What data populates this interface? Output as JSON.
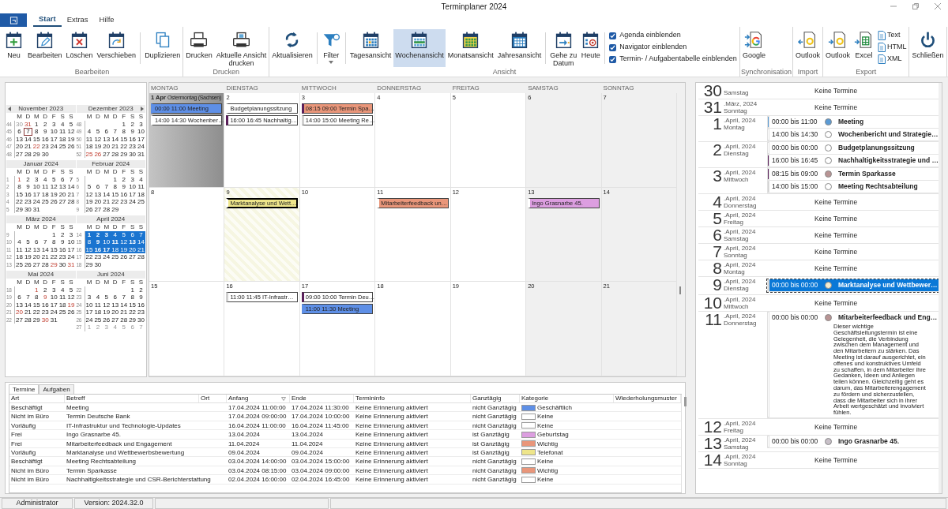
{
  "window": {
    "title": "Terminplaner 2024"
  },
  "ribbon_tabs": [
    {
      "label": "Start",
      "selected": true
    },
    {
      "label": "Extras",
      "selected": false
    },
    {
      "label": "Hilfe",
      "selected": false
    }
  ],
  "ribbon_groups": [
    {
      "label": "Bearbeiten",
      "items": [
        {
          "kind": "large",
          "label": "Neu",
          "selected": false
        },
        {
          "kind": "large",
          "label": "Bearbeiten",
          "selected": false
        },
        {
          "kind": "large",
          "label": "Löschen",
          "selected": false
        },
        {
          "kind": "large",
          "label": "Verschieben",
          "selected": false
        },
        {
          "kind": "separator"
        },
        {
          "kind": "large",
          "label": "Duplizieren",
          "selected": false
        }
      ]
    },
    {
      "label": "Drucken",
      "items": [
        {
          "kind": "large",
          "label": "Drucken",
          "selected": false
        },
        {
          "kind": "large",
          "label": "Aktuelle Ansicht\ndrucken",
          "selected": false
        }
      ]
    },
    {
      "label": "Ansicht",
      "items": [
        {
          "kind": "large",
          "label": "Aktualisieren",
          "selected": false
        },
        {
          "kind": "separator"
        },
        {
          "kind": "large",
          "label": "Filter",
          "selected": false,
          "dropdown": true
        },
        {
          "kind": "separator"
        },
        {
          "kind": "large",
          "label": "Tagesansicht",
          "selected": false
        },
        {
          "kind": "large",
          "label": "Wochenansicht",
          "selected": true
        },
        {
          "kind": "large",
          "label": "Monatsansicht",
          "selected": false
        },
        {
          "kind": "large",
          "label": "Jahresansicht",
          "selected": false
        },
        {
          "kind": "separator"
        },
        {
          "kind": "large",
          "label": "Gehe zu\nDatum",
          "selected": false
        },
        {
          "kind": "large",
          "label": "Heute",
          "selected": false
        },
        {
          "kind": "separator"
        },
        {
          "kind": "checkbox",
          "label": "Agenda einblenden",
          "checked": true
        },
        {
          "kind": "checkbox",
          "label": "Navigator einblenden",
          "checked": true
        },
        {
          "kind": "checkbox",
          "label": "Termin- / Aufgabentabelle einblenden",
          "checked": true
        }
      ]
    },
    {
      "label": "Synchronisation",
      "items": [
        {
          "kind": "large",
          "label": "Google",
          "selected": false
        }
      ]
    },
    {
      "label": "Import",
      "items": [
        {
          "kind": "large",
          "label": "Outlook",
          "selected": false
        }
      ]
    },
    {
      "label": "Export",
      "items": [
        {
          "kind": "large",
          "label": "Outlook",
          "selected": false
        },
        {
          "kind": "large",
          "label": "Excel",
          "selected": false
        },
        {
          "kind": "small",
          "label": "Text"
        },
        {
          "kind": "small",
          "label": "HTML"
        },
        {
          "kind": "small",
          "label": "XML"
        }
      ]
    },
    {
      "items": [
        {
          "kind": "large",
          "label": "Schließen",
          "selected": false
        }
      ]
    }
  ],
  "mini_calendars": [
    {
      "title": "November 2023",
      "weekdays": [
        "M",
        "D",
        "M",
        "D",
        "F",
        "S",
        "S"
      ],
      "weeks": [
        {
          "week": "44",
          "selected": false,
          "days": [
            {
              "d": "30",
              "kind": "other"
            },
            {
              "d": "31",
              "kind": "holiday"
            },
            "1",
            "2",
            "3",
            "4",
            "5"
          ]
        },
        {
          "week": "45",
          "selected": false,
          "days": [
            "6",
            {
              "d": "7",
              "kind": "today"
            },
            "8",
            "9",
            "10",
            "11",
            "12"
          ]
        },
        {
          "week": "46",
          "selected": false,
          "days": [
            "13",
            "14",
            "15",
            "16",
            "17",
            "18",
            "19"
          ]
        },
        {
          "week": "47",
          "selected": false,
          "days": [
            "20",
            "21",
            {
              "d": "22",
              "kind": "holiday"
            },
            "23",
            "24",
            "25",
            "26"
          ]
        },
        {
          "week": "48",
          "selected": false,
          "days": [
            "27",
            "28",
            "29",
            "30"
          ]
        }
      ]
    },
    {
      "title": "Dezember 2023",
      "weekdays": [
        "M",
        "D",
        "M",
        "D",
        "F",
        "S",
        "S"
      ],
      "weeks": [
        {
          "week": "48",
          "selected": false,
          "days": [
            "1",
            "2",
            "3"
          ]
        },
        {
          "week": "49",
          "selected": false,
          "days": [
            "4",
            "5",
            "6",
            "7",
            "8",
            "9",
            "10"
          ]
        },
        {
          "week": "50",
          "selected": false,
          "days": [
            "11",
            "12",
            "13",
            "14",
            "15",
            "16",
            "17"
          ]
        },
        {
          "week": "51",
          "selected": false,
          "days": [
            "18",
            "19",
            "20",
            "21",
            "22",
            "23",
            "24"
          ]
        },
        {
          "week": "52",
          "selected": false,
          "days": [
            {
              "d": "25",
              "kind": "holiday"
            },
            {
              "d": "26",
              "kind": "holiday"
            },
            "27",
            "28",
            "29",
            "30",
            "31"
          ]
        }
      ]
    },
    {
      "title": "Januar 2024",
      "weekdays": [
        "M",
        "D",
        "M",
        "D",
        "F",
        "S",
        "S"
      ],
      "weeks": [
        {
          "week": "1",
          "selected": false,
          "days": [
            {
              "d": "1",
              "kind": "holiday"
            },
            "2",
            "3",
            "4",
            "5",
            "6",
            "7"
          ]
        },
        {
          "week": "2",
          "selected": false,
          "days": [
            "8",
            "9",
            "10",
            "11",
            "12",
            "13",
            "14"
          ]
        },
        {
          "week": "3",
          "selected": false,
          "days": [
            "15",
            "16",
            "17",
            "18",
            "19",
            "20",
            "21"
          ]
        },
        {
          "week": "4",
          "selected": false,
          "days": [
            "22",
            "23",
            "24",
            "25",
            "26",
            "27",
            "28"
          ]
        },
        {
          "week": "5",
          "selected": false,
          "days": [
            "29",
            "30",
            "31"
          ]
        }
      ]
    },
    {
      "title": "Februar 2024",
      "weekdays": [
        "M",
        "D",
        "M",
        "D",
        "F",
        "S",
        "S"
      ],
      "weeks": [
        {
          "week": "5",
          "selected": false,
          "days": [
            "1",
            "2",
            "3",
            "4"
          ]
        },
        {
          "week": "6",
          "selected": false,
          "days": [
            "5",
            "6",
            "7",
            "8",
            "9",
            "10",
            "11"
          ]
        },
        {
          "week": "7",
          "selected": false,
          "days": [
            "12",
            "13",
            "14",
            "15",
            "16",
            "17",
            "18"
          ]
        },
        {
          "week": "8",
          "selected": false,
          "days": [
            "19",
            "20",
            "21",
            "22",
            "23",
            "24",
            "25"
          ]
        },
        {
          "week": "9",
          "selected": false,
          "days": [
            "26",
            "27",
            "28",
            "29"
          ]
        }
      ]
    },
    {
      "title": "März 2024",
      "weekdays": [
        "M",
        "D",
        "M",
        "D",
        "F",
        "S",
        "S"
      ],
      "weeks": [
        {
          "week": "9",
          "selected": false,
          "days": [
            "1",
            "2",
            "3"
          ]
        },
        {
          "week": "10",
          "selected": false,
          "days": [
            "4",
            "5",
            "6",
            "7",
            "8",
            "9",
            "10"
          ]
        },
        {
          "week": "11",
          "selected": false,
          "days": [
            "11",
            "12",
            "13",
            "14",
            "15",
            "16",
            "17"
          ]
        },
        {
          "week": "12",
          "selected": false,
          "days": [
            "18",
            "19",
            "20",
            "21",
            "22",
            "23",
            "24"
          ]
        },
        {
          "week": "13",
          "selected": false,
          "days": [
            "25",
            "26",
            "27",
            "28",
            {
              "d": "29",
              "kind": "holiday"
            },
            "30",
            {
              "d": "31",
              "kind": "holiday"
            }
          ]
        }
      ]
    },
    {
      "title": "April 2024",
      "weekdays": [
        "M",
        "D",
        "M",
        "D",
        "F",
        "S",
        "S"
      ],
      "weeks": [
        {
          "week": "14",
          "selected": true,
          "days": [
            {
              "d": "1",
              "kind": "holiday"
            },
            {
              "d": "2",
              "kind": "busy"
            },
            {
              "d": "3",
              "kind": "busy"
            },
            "4",
            "5",
            "6",
            "7"
          ]
        },
        {
          "week": "15",
          "selected": true,
          "days": [
            "8",
            {
              "d": "9",
              "kind": "busy"
            },
            "10",
            {
              "d": "11",
              "kind": "busy"
            },
            "12",
            {
              "d": "13",
              "kind": "busy"
            },
            "14"
          ]
        },
        {
          "week": "16",
          "selected": true,
          "days": [
            "15",
            {
              "d": "16",
              "kind": "busy"
            },
            {
              "d": "17",
              "kind": "busy"
            },
            "18",
            "19",
            "20",
            "21"
          ]
        },
        {
          "week": "17",
          "selected": false,
          "days": [
            "22",
            "23",
            "24",
            "25",
            "26",
            "27",
            "28"
          ]
        },
        {
          "week": "18",
          "selected": false,
          "days": [
            "29",
            "30"
          ]
        }
      ]
    },
    {
      "title": "Mai 2024",
      "weekdays": [
        "M",
        "D",
        "M",
        "D",
        "F",
        "S",
        "S"
      ],
      "weeks": [
        {
          "week": "18",
          "selected": false,
          "days": [
            {
              "d": "1",
              "kind": "holiday"
            },
            "2",
            "3",
            "4",
            "5"
          ]
        },
        {
          "week": "19",
          "selected": false,
          "days": [
            "6",
            "7",
            "8",
            {
              "d": "9",
              "kind": "holiday"
            },
            "10",
            "11",
            "12"
          ]
        },
        {
          "week": "20",
          "selected": false,
          "days": [
            "13",
            "14",
            "15",
            "16",
            "17",
            "18",
            {
              "d": "19",
              "kind": "holiday"
            }
          ]
        },
        {
          "week": "21",
          "selected": false,
          "days": [
            {
              "d": "20",
              "kind": "holiday"
            },
            "21",
            "22",
            "23",
            "24",
            "25",
            "26"
          ]
        },
        {
          "week": "22",
          "selected": false,
          "days": [
            "27",
            "28",
            "29",
            {
              "d": "30",
              "kind": "holiday"
            },
            "31"
          ]
        }
      ]
    },
    {
      "title": "Juni 2024",
      "weekdays": [
        "M",
        "D",
        "M",
        "D",
        "F",
        "S",
        "S"
      ],
      "weeks": [
        {
          "week": "22",
          "selected": false,
          "days": [
            "1",
            "2"
          ]
        },
        {
          "week": "23",
          "selected": false,
          "days": [
            "3",
            "4",
            "5",
            "6",
            "7",
            "8",
            "9"
          ]
        },
        {
          "week": "24",
          "selected": false,
          "days": [
            "10",
            "11",
            "12",
            "13",
            "14",
            "15",
            "16"
          ]
        },
        {
          "week": "25",
          "selected": false,
          "days": [
            "17",
            "18",
            "19",
            "20",
            "21",
            "22",
            "23"
          ]
        },
        {
          "week": "26",
          "selected": false,
          "days": [
            "24",
            "25",
            "26",
            "27",
            "28",
            "29",
            "30"
          ]
        },
        {
          "week": "27",
          "selected": false,
          "days": [
            {
              "d": "1",
              "kind": "other"
            },
            {
              "d": "2",
              "kind": "other"
            },
            {
              "d": "3",
              "kind": "other"
            },
            {
              "d": "4",
              "kind": "other"
            },
            {
              "d": "5",
              "kind": "other"
            },
            {
              "d": "6",
              "kind": "other"
            },
            {
              "d": "7",
              "kind": "other"
            }
          ]
        }
      ]
    }
  ],
  "week_view": {
    "columns": [
      "MONTAG",
      "DIENSTAG",
      "MITTWOCH",
      "DONNERSTAG",
      "FREITAG",
      "SAMSTAG",
      "SONNTAG"
    ],
    "rows": [
      {
        "cells": [
          {
            "label": "1 Apr",
            "note": "Ostermontag (Sachsen)",
            "kind": "holiday",
            "events": [
              {
                "text": "00:00 11:00 Meeting",
                "color": "#5e8fe6",
                "kind": "busy",
                "selected": false
              },
              {
                "text": "14:00 14:30 Wochenber…",
                "color": "#ffffff",
                "kind": "busy",
                "selected": false
              }
            ]
          },
          {
            "label": "2",
            "kind": "normal",
            "events": [
              {
                "text": "Budgetplanungssitzung",
                "color": "#ffffff",
                "kind": "busy",
                "selected": false
              },
              {
                "text": "16:00 16:45 Nachhaltig…",
                "color": "#ffffff",
                "kind": "out",
                "selected": false
              }
            ]
          },
          {
            "label": "3",
            "kind": "normal",
            "events": [
              {
                "text": "08:15 09:00 Termin Spa…",
                "color": "#e9967a",
                "kind": "out",
                "selected": false
              },
              {
                "text": "14:00 15:00 Meeting Re…",
                "color": "#ffffff",
                "kind": "tentative",
                "selected": false
              }
            ]
          },
          {
            "label": "4",
            "kind": "normal"
          },
          {
            "label": "5",
            "kind": "normal"
          },
          {
            "label": "6",
            "kind": "weekend"
          },
          {
            "label": "7",
            "kind": "weekend"
          }
        ]
      },
      {
        "cells": [
          {
            "label": "8",
            "kind": "normal"
          },
          {
            "label": "9",
            "kind": "tentative",
            "events": [
              {
                "text": "Marktanalyse und Wett…",
                "color": "#eee58a",
                "kind": "free",
                "selected": true
              }
            ]
          },
          {
            "label": "10",
            "kind": "normal"
          },
          {
            "label": "11",
            "kind": "normal",
            "events": [
              {
                "text": "Mitarbeiterfeedback un…",
                "color": "#e9967a",
                "kind": "free",
                "selected": false
              }
            ]
          },
          {
            "label": "12",
            "kind": "normal"
          },
          {
            "label": "13",
            "kind": "weekend",
            "events": [
              {
                "text": "Ingo Grasnarbe 45.",
                "color": "#dc9ee0",
                "kind": "free",
                "selected": false
              }
            ]
          },
          {
            "label": "14",
            "kind": "weekend"
          }
        ]
      },
      {
        "cells": [
          {
            "label": "15",
            "kind": "normal"
          },
          {
            "label": "16",
            "kind": "normal",
            "events": [
              {
                "text": "11:00 11:45 IT-Infrastr…",
                "color": "#ffffff",
                "kind": "tentative",
                "selected": false
              }
            ]
          },
          {
            "label": "17",
            "kind": "normal",
            "events": [
              {
                "text": "09:00 10:00 Termin Deu…",
                "color": "#ffffff",
                "kind": "out",
                "selected": false
              },
              {
                "text": "11:00 11:30 Meeting",
                "color": "#5e8fe6",
                "kind": "busy",
                "selected": false
              }
            ]
          },
          {
            "label": "18",
            "kind": "normal"
          },
          {
            "label": "19",
            "kind": "normal"
          },
          {
            "label": "20",
            "kind": "weekend"
          },
          {
            "label": "21",
            "kind": "weekend"
          }
        ]
      }
    ]
  },
  "agenda": {
    "days": [
      {
        "day": "30",
        "weekday": "Samstag",
        "empty": "Keine Termine"
      },
      {
        "day": "31",
        "month": ".März, 2024",
        "weekday": "Sonntag",
        "empty": "Keine Termine"
      },
      {
        "day": "1",
        "month": ".April, 2024",
        "weekday": "Montag",
        "items": [
          {
            "time": "00:00 bis 11:00",
            "title": "Meeting",
            "color": "#5b9bd5",
            "kind": "busy",
            "selected": false
          },
          {
            "time": "14:00 bis 14:30",
            "title": "Wochenbericht und Strategie…",
            "color": "#ffffff",
            "kind": "free",
            "selected": false
          }
        ]
      },
      {
        "day": "2",
        "month": ".April, 2024",
        "weekday": "Dienstag",
        "items": [
          {
            "time": "00:00 bis 00:00",
            "title": "Budgetplanungssitzung",
            "color": "#ffffff",
            "kind": "free",
            "selected": false
          },
          {
            "time": "16:00 bis 16:45",
            "title": "Nachhaltigkeitsstrategie und …",
            "color": "#ffffff",
            "kind": "out",
            "selected": false
          }
        ]
      },
      {
        "day": "3",
        "month": ".April, 2024",
        "weekday": "Mittwoch",
        "items": [
          {
            "time": "08:15 bis 09:00",
            "title": "Termin Sparkasse",
            "color": "#b89494",
            "kind": "out",
            "selected": false
          },
          {
            "time": "14:00 bis 15:00",
            "title": "Meeting Rechtsabteilung",
            "color": "#ffffff",
            "kind": "tentative",
            "selected": false
          }
        ]
      },
      {
        "day": "4",
        "month": ".April, 2024",
        "weekday": "Donnerstag",
        "empty": "Keine Termine"
      },
      {
        "day": "5",
        "month": ".April, 2024",
        "weekday": "Freitag",
        "empty": "Keine Termine"
      },
      {
        "day": "6",
        "month": ".April, 2024",
        "weekday": "Samstag",
        "empty": "Keine Termine"
      },
      {
        "day": "7",
        "month": ".April, 2024",
        "weekday": "Sonntag",
        "empty": "Keine Termine"
      },
      {
        "day": "8",
        "month": ".April, 2024",
        "weekday": "Montag",
        "empty": "Keine Termine"
      },
      {
        "day": "9",
        "month": ".April, 2024",
        "weekday": "Dienstag",
        "items": [
          {
            "time": "00:00 bis 00:00",
            "title": "Marktanalyse und Wettbewer…",
            "color": "#f3ecd0",
            "kind": "tentative",
            "selected": true
          }
        ]
      },
      {
        "day": "10",
        "month": ".April, 2024",
        "weekday": "Mittwoch",
        "empty": "Keine Termine"
      },
      {
        "day": "11",
        "month": ".April, 2024",
        "weekday": "Donnerstag",
        "items": [
          {
            "time": "00:00 bis 00:00",
            "title": "Mitarbeiterfeedback und Eng…",
            "color": "#b89494",
            "kind": "free",
            "selected": false,
            "description": "Dieser wichtige Geschäftsleitungstermin ist eine Gelegenheit, die Verbindung zwischen dem Management und den Mitarbeitern zu stärken. Das Meeting ist darauf ausgerichtet, ein offenes und konstruktives Umfeld zu schaffen, in dem Mitarbeiter ihre Gedanken, Ideen und Anliegen teilen können. Gleichzeitig geht es darum, das Mitarbeiterengagement zu fördern und sicherzustellen, dass die Mitarbeiter sich in ihrer Arbeit wertgeschätzt und involviert fühlen."
          }
        ]
      },
      {
        "day": "12",
        "month": ".April, 2024",
        "weekday": "Freitag",
        "empty": "Keine Termine"
      },
      {
        "day": "13",
        "month": ".April, 2024",
        "weekday": "Samstag",
        "items": [
          {
            "time": "00:00 bis 00:00",
            "title": "Ingo Grasnarbe 45.",
            "color": "#c8c0c8",
            "kind": "free",
            "selected": false
          }
        ]
      },
      {
        "day": "14",
        "month": ".April, 2024",
        "weekday": "Sonntag",
        "empty": "Keine Termine"
      }
    ]
  },
  "table": {
    "tabs": [
      {
        "label": "Termine",
        "selected": true
      },
      {
        "label": "Aufgaben",
        "selected": false
      }
    ],
    "columns": [
      {
        "label": "Art",
        "sorted": false
      },
      {
        "label": "Betreff",
        "sorted": false
      },
      {
        "label": "Ort",
        "sorted": false
      },
      {
        "label": "Anfang",
        "sorted": true
      },
      {
        "label": "Ende",
        "sorted": false
      },
      {
        "label": "Termininfo",
        "sorted": false
      },
      {
        "label": "Ganztägig",
        "sorted": false
      },
      {
        "label": "Kategorie",
        "sorted": false
      },
      {
        "label": "Wiederholungsmuster",
        "sorted": false
      }
    ],
    "rows": [
      {
        "art": "Beschäftigt",
        "subject": "Meeting",
        "start": "17.04.2024 11:00:00",
        "end": "17.04.2024 11:30:00",
        "info": "Keine Erinnerung aktiviert",
        "all_day": "nicht Ganztägig",
        "category": "Geschäftlich",
        "color": "#5e8fe6"
      },
      {
        "art": "Nicht im Büro",
        "subject": "Termin Deutsche Bank",
        "start": "17.04.2024 09:00:00",
        "end": "17.04.2024 10:00:00",
        "info": "Keine Erinnerung aktiviert",
        "all_day": "nicht Ganztägig",
        "category": "Keine",
        "color": "#ffffff"
      },
      {
        "art": "Vorläufig",
        "subject": "IT-Infrastruktur und Technologie-Updates",
        "start": "16.04.2024 11:00:00",
        "end": "16.04.2024 11:45:00",
        "info": "Keine Erinnerung aktiviert",
        "all_day": "nicht Ganztägig",
        "category": "Keine",
        "color": "#ffffff"
      },
      {
        "art": "Frei",
        "subject": "Ingo Grasnarbe 45.",
        "start": "13.04.2024",
        "end": "13.04.2024",
        "info": "Keine Erinnerung aktiviert",
        "all_day": "ist Ganztägig",
        "category": "Geburtstag",
        "color": "#dc9ee0"
      },
      {
        "art": "Frei",
        "subject": "Mitarbeiterfeedback und Engagement",
        "start": "11.04.2024",
        "end": "11.04.2024",
        "info": "Keine Erinnerung aktiviert",
        "all_day": "ist Ganztägig",
        "category": "Wichtig",
        "color": "#e9967a"
      },
      {
        "art": "Vorläufig",
        "subject": "Marktanalyse und Wettbewerbsbewertung",
        "start": "09.04.2024",
        "end": "09.04.2024",
        "info": "Keine Erinnerung aktiviert",
        "all_day": "ist Ganztägig",
        "category": "Telefonat",
        "color": "#eee58a"
      },
      {
        "art": "Beschäftigt",
        "subject": "Meeting Rechtsabteilung",
        "start": "03.04.2024 14:00:00",
        "end": "03.04.2024 15:00:00",
        "info": "Keine Erinnerung aktiviert",
        "all_day": "nicht Ganztägig",
        "category": "Keine",
        "color": "#ffffff"
      },
      {
        "art": "Nicht im Büro",
        "subject": "Termin Sparkasse",
        "start": "03.04.2024 08:15:00",
        "end": "03.04.2024 09:00:00",
        "info": "Keine Erinnerung aktiviert",
        "all_day": "nicht Ganztägig",
        "category": "Wichtig",
        "color": "#e9967a"
      },
      {
        "art": "Nicht im Büro",
        "subject": "Nachhaltigkeitsstrategie und CSR-Berichterstattung",
        "start": "02.04.2024 16:00:00",
        "end": "02.04.2024 16:45:00",
        "info": "Keine Erinnerung aktiviert",
        "all_day": "nicht Ganztägig",
        "category": "Keine",
        "color": "#ffffff"
      }
    ]
  },
  "status_bar": [
    "Administrator",
    "Version: 2024.32.0"
  ]
}
